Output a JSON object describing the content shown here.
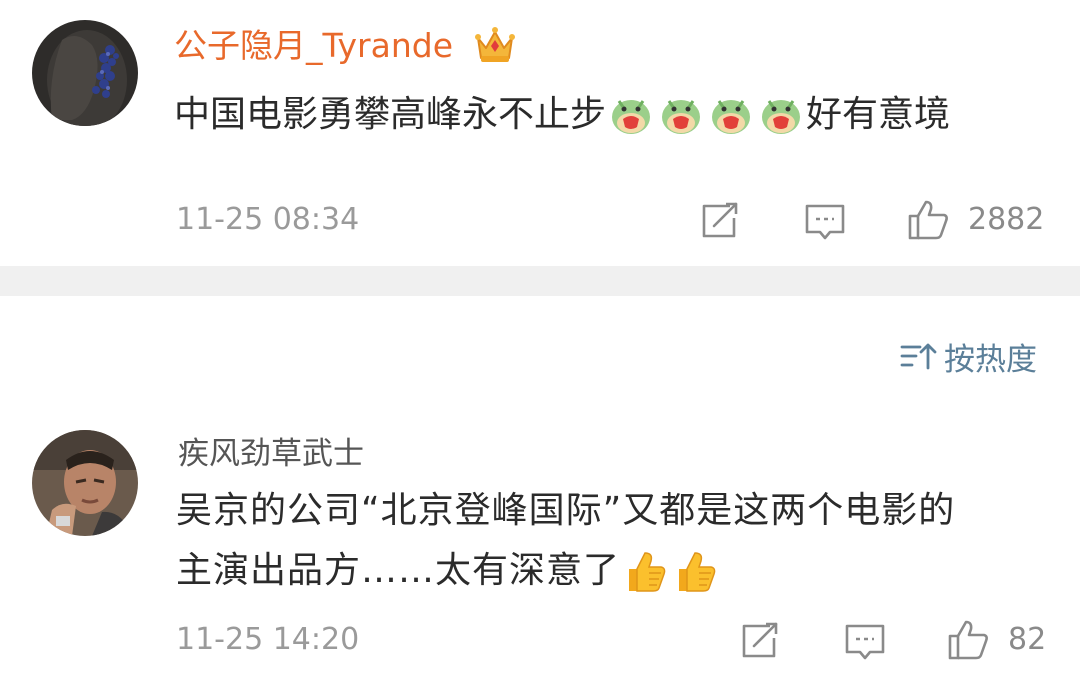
{
  "comments": [
    {
      "username": "公子隐月_Tyrande",
      "text_before_emoji": "中国电影勇攀高峰永不止步",
      "emoji_icon": "nervous-dog-emoji",
      "emoji_count": 4,
      "text_after_emoji": "好有意境",
      "timestamp": "11-25 08:34",
      "likes": "2882",
      "badge_icon": "crown-vip-icon"
    },
    {
      "username": "疾风劲草武士",
      "line1": "吴京的公司“北京登峰国际”又都是这两个电影的",
      "line2_text": "主演出品方……太有深意了",
      "emoji_icon": "thumbs-up-emoji",
      "emoji_count": 2,
      "timestamp": "11-25 14:20",
      "likes": "82"
    }
  ],
  "sort": {
    "label": "按热度",
    "icon": "sort-icon"
  },
  "colors": {
    "vip_name": "#e8692b",
    "normal_name": "#555555",
    "text": "#2b2b2b",
    "meta": "#9a9a9a",
    "icon": "#8a8a8a",
    "sort": "#5b7f99",
    "divider": "#f0f0f0"
  }
}
